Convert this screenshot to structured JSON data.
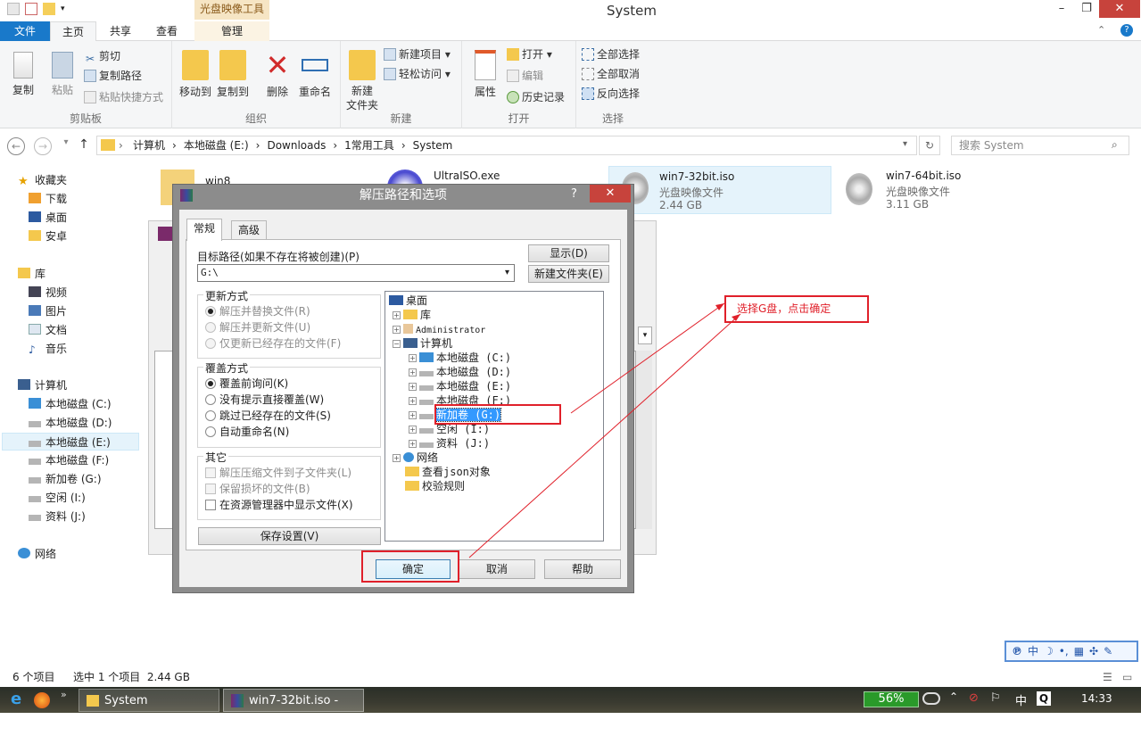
{
  "window": {
    "title": "System",
    "context_group": "光盘映像工具"
  },
  "tabs": [
    "文件",
    "主页",
    "共享",
    "查看",
    "管理"
  ],
  "ribbon": {
    "clipboard": {
      "copy": "复制",
      "paste": "粘贴",
      "cut": "剪切",
      "copy_path": "复制路径",
      "paste_shortcut": "粘贴快捷方式",
      "label": "剪贴板"
    },
    "organize": {
      "move_to": "移动到",
      "copy_to": "复制到",
      "delete": "删除",
      "rename": "重命名",
      "label": "组织"
    },
    "new": {
      "new_folder": "新建\n文件夹",
      "new_item": "新建项目",
      "easy_access": "轻松访问",
      "label": "新建"
    },
    "open": {
      "properties": "属性",
      "open": "打开",
      "edit": "编辑",
      "history": "历史记录",
      "label": "打开"
    },
    "select": {
      "select_all": "全部选择",
      "select_none": "全部取消",
      "invert": "反向选择",
      "label": "选择"
    }
  },
  "address": {
    "crumbs": [
      "计算机",
      "本地磁盘 (E:)",
      "Downloads",
      "1常用工具",
      "System"
    ],
    "search_placeholder": "搜索 System"
  },
  "nav": {
    "favorites": {
      "label": "收藏夹",
      "items": [
        "下载",
        "桌面",
        "安卓"
      ]
    },
    "libraries": {
      "label": "库",
      "items": [
        "视频",
        "图片",
        "文档",
        "音乐"
      ]
    },
    "computer": {
      "label": "计算机",
      "items": [
        "本地磁盘 (C:)",
        "本地磁盘 (D:)",
        "本地磁盘 (E:)",
        "本地磁盘 (F:)",
        "新加卷 (G:)",
        "空闲 (I:)",
        "资料 (J:)"
      ]
    },
    "network": {
      "label": "网络"
    }
  },
  "files": [
    {
      "name": "win8",
      "type": "",
      "size": ""
    },
    {
      "name": "UltraISO.exe",
      "type": "",
      "size": ""
    },
    {
      "name": "win7-32bit.iso",
      "type": "光盘映像文件",
      "size": "2.44 GB"
    },
    {
      "name": "win7-64bit.iso",
      "type": "光盘映像文件",
      "size": "3.11 GB"
    }
  ],
  "dialog": {
    "title": "解压路径和选项",
    "help": "?",
    "tabs": [
      "常规",
      "高级"
    ],
    "target_label": "目标路径(如果不存在将被创建)(P)",
    "target_value": "G:\\",
    "show_btn": "显示(D)",
    "new_folder_btn": "新建文件夹(E)",
    "update": {
      "title": "更新方式",
      "options": [
        "解压并替换文件(R)",
        "解压并更新文件(U)",
        "仅更新已经存在的文件(F)"
      ]
    },
    "overwrite": {
      "title": "覆盖方式",
      "options": [
        "覆盖前询问(K)",
        "没有提示直接覆盖(W)",
        "跳过已经存在的文件(S)",
        "自动重命名(N)"
      ]
    },
    "misc": {
      "title": "其它",
      "options": [
        "解压压缩文件到子文件夹(L)",
        "保留损坏的文件(B)",
        "在资源管理器中显示文件(X)"
      ]
    },
    "save_btn": "保存设置(V)",
    "tree": [
      "桌面",
      "库",
      "Administrator",
      "计算机",
      "本地磁盘 (C:)",
      "本地磁盘 (D:)",
      "本地磁盘 (E:)",
      "本地磁盘 (F:)",
      "新加卷 (G:)",
      "空闲 (I:)",
      "资料 (J:)",
      "网络",
      "查看json对象",
      "校验规则"
    ],
    "ok": "确定",
    "cancel": "取消",
    "help_btn": "帮助"
  },
  "annotation": "选择G盘，点击确定",
  "status": {
    "count": "6 个项目",
    "selected": "选中 1 个项目  2.44 GB"
  },
  "taskbar": {
    "items": [
      "System",
      "win7-32bit.iso - Wi..."
    ],
    "battery": "56%",
    "time": "14:33",
    "ime": "中"
  },
  "ime_bar": "中",
  "colors": {
    "accent": "#1979ca",
    "annotation": "#e0202a",
    "close": "#c7433c"
  }
}
